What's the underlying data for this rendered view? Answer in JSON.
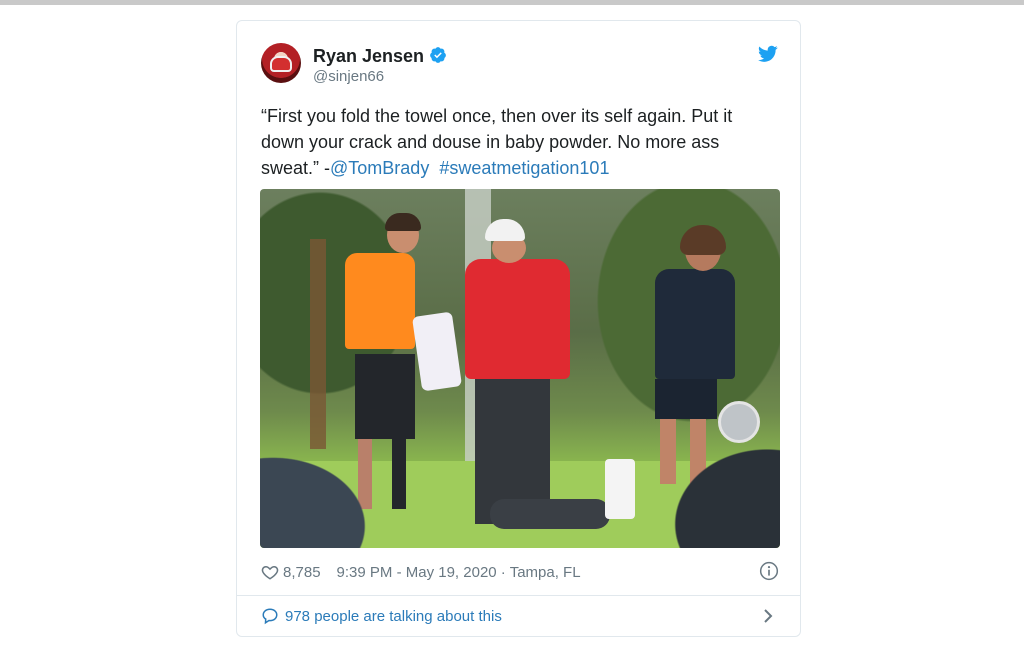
{
  "tweet": {
    "author_name": "Ryan Jensen",
    "handle": "@sinjen66",
    "text_plain": "“First you fold the towel once, then over its self again.  Put it down your crack and douse in baby powder.  No more ass sweat.” -",
    "mention": "@TomBrady",
    "hashtag": "#sweatmetigation101",
    "likes": "8,785",
    "timestamp": "9:39 PM - May 19, 2020 · Tampa, FL",
    "talking": "978 people are talking about this"
  },
  "icons": {
    "verified": "verified-badge-icon",
    "platform": "twitter-bird-icon",
    "like": "heart-icon",
    "info": "info-icon",
    "reply": "speech-bubble-icon",
    "more": "chevron-right-icon"
  },
  "colors": {
    "link": "#2b7bb9",
    "verified": "#1da1f2",
    "text": "#1c2022",
    "secondary": "#697882"
  }
}
